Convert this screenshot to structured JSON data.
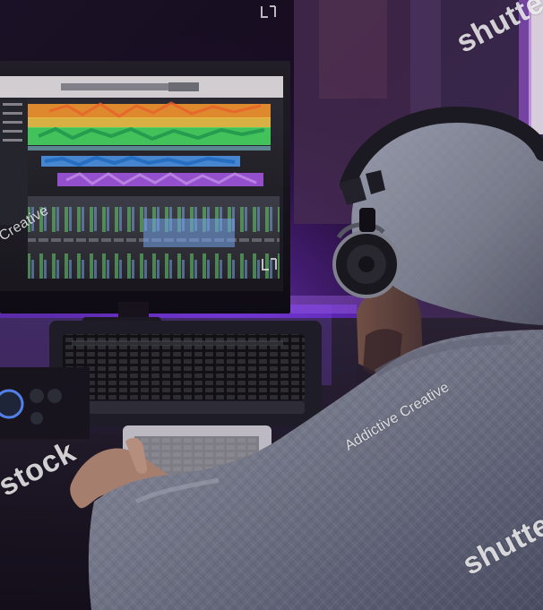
{
  "watermark": {
    "brand_top_right": "shutte",
    "brand_left": "stock",
    "brand_bottom_right": "shutte",
    "credit_left": "Creative",
    "credit_center": "Addictive Creative"
  },
  "icons": [
    "corner-bracket-icon",
    "headphones-icon"
  ],
  "colors": {
    "background_dark": "#0b0711",
    "purple_light": "#8f47ff",
    "sweater_gray": "#7c8392",
    "screen_white": "#e6e5e4",
    "track_orange": "#ff9f2e",
    "track_green": "#4cf06b",
    "track_blue": "#53a8ff",
    "track_purple": "#b864ff"
  }
}
